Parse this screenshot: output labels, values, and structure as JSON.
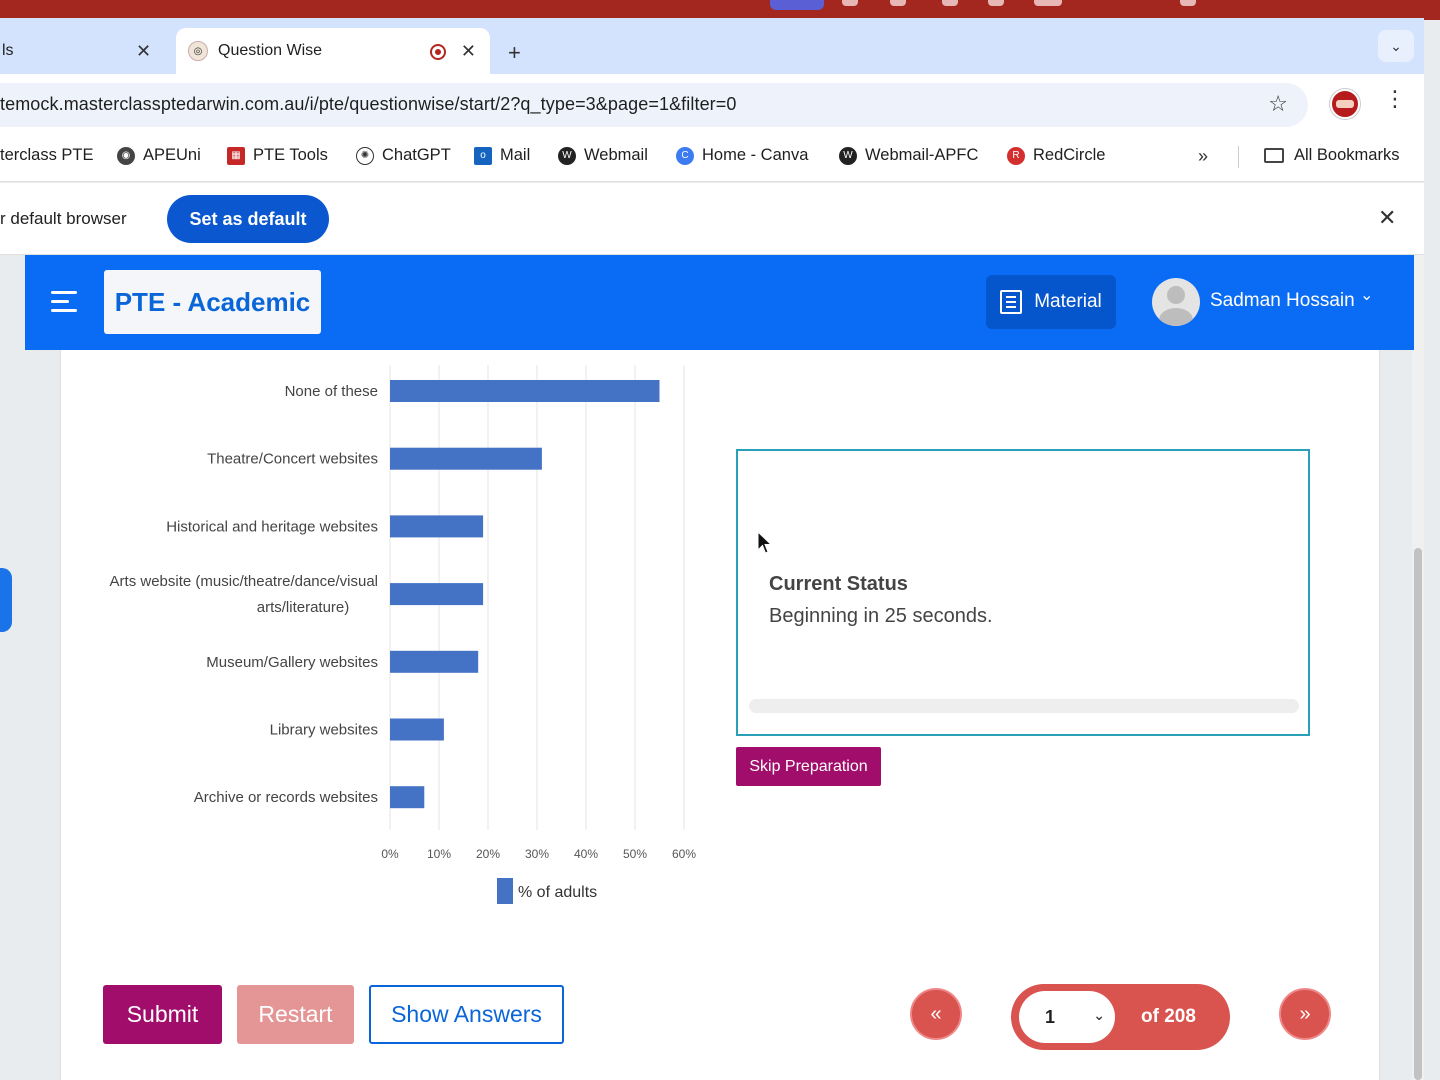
{
  "browser": {
    "prev_tab_title": "ls",
    "active_tab_title": "Question Wise",
    "new_tab_symbol": "+",
    "url": "temock.masterclassptedarwin.com.au/i/pte/questionwise/start/2?q_type=3&page=1&filter=0",
    "bookmarks": [
      {
        "label": "terclass PTE",
        "icon": "none"
      },
      {
        "label": "APEUni",
        "icon": "apeuni-icon",
        "color": "#444444"
      },
      {
        "label": "PTE Tools",
        "icon": "pte-tools-icon",
        "color": "#c62828"
      },
      {
        "label": "ChatGPT",
        "icon": "chatgpt-icon",
        "color": "#333333"
      },
      {
        "label": "Mail",
        "icon": "outlook-icon",
        "color": "#1565c0"
      },
      {
        "label": "Webmail",
        "icon": "webmail-icon",
        "color": "#222222"
      },
      {
        "label": "Home - Canva",
        "icon": "canva-icon",
        "color": "#3d7cf0"
      },
      {
        "label": "Webmail-APFC",
        "icon": "webmail-icon",
        "color": "#222222"
      },
      {
        "label": "RedCircle",
        "icon": "redcircle-icon",
        "color": "#d32f2f"
      }
    ],
    "more_bookmarks": "»",
    "all_bookmarks": "All Bookmarks",
    "default_bar_text": "r default browser",
    "set_default_label": "Set as default"
  },
  "header": {
    "brand": "PTE - Academic",
    "material_label": "Material",
    "user_name": "Sadman Hossain",
    "accent": "#0a6cf5"
  },
  "chart_data": {
    "type": "bar",
    "orientation": "horizontal",
    "categories": [
      "None of these",
      "Theatre/Concert websites",
      "Historical and heritage websites",
      "Arts website (music/theatre/dance/visual arts/literature)",
      "Museum/Gallery websites",
      "Library websites",
      "Archive or records websites"
    ],
    "category_lines": [
      [
        "None of these"
      ],
      [
        "Theatre/Concert websites"
      ],
      [
        "Historical and heritage websites"
      ],
      [
        "Arts website (music/theatre/dance/visual",
        "arts/literature)"
      ],
      [
        "Museum/Gallery websites"
      ],
      [
        "Library websites"
      ],
      [
        "Archive or records websites"
      ]
    ],
    "series": [
      {
        "name": "% of adults",
        "values": [
          55,
          31,
          19,
          19,
          18,
          11,
          7
        ],
        "color": "#4472c4"
      }
    ],
    "xlim": [
      0,
      60
    ],
    "ticks": [
      "0%",
      "10%",
      "20%",
      "30%",
      "40%",
      "50%",
      "60%"
    ],
    "tick_values": [
      0,
      10,
      20,
      30,
      40,
      50,
      60
    ],
    "grid": true,
    "legend": "bottom"
  },
  "status": {
    "title": "Current Status",
    "text": "Beginning in 25 seconds.",
    "progress_fraction": 0.0
  },
  "actions": {
    "skip": "Skip Preparation",
    "submit": "Submit",
    "restart": "Restart",
    "show_answers": "Show Answers",
    "prev": "«",
    "next": "»",
    "page_value": "1",
    "page_total": "of 208"
  }
}
